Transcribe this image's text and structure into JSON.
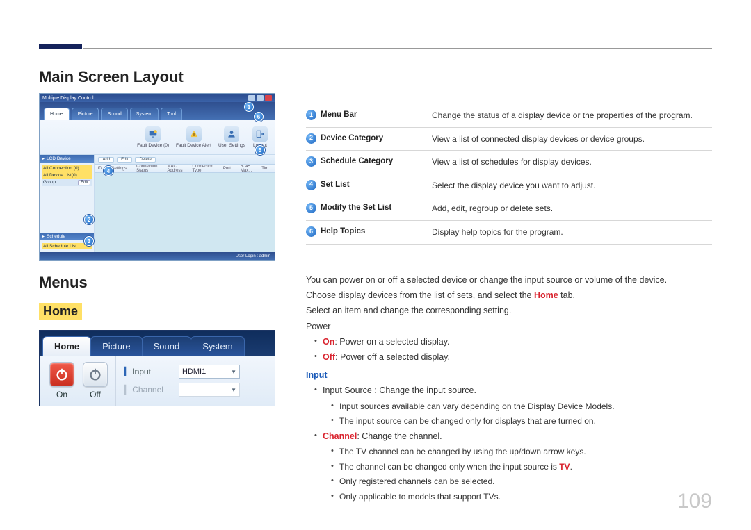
{
  "page_number": "109",
  "h_main_screen": "Main Screen Layout",
  "h_menus": "Menus",
  "h_home": "Home",
  "mdc": {
    "title": "Multiple Display Control",
    "tabs": [
      "Home",
      "Picture",
      "Sound",
      "System",
      "Tool"
    ],
    "ribbon": [
      {
        "label": "Fault Device (0)"
      },
      {
        "label": "Fault Device Alert"
      },
      {
        "label": "User Settings"
      },
      {
        "label": "Logout"
      }
    ],
    "side_lfd_hdr": "LCD Device",
    "side_all_conn": "All Connection (0)",
    "side_all_dev": "All Device List(0)",
    "side_group": "Group",
    "side_edit": "Edit",
    "side_sched_hdr": "Schedule",
    "side_sched_all": "All Schedule List",
    "toolbar": [
      "Add",
      "Edit",
      "Delete"
    ],
    "cols": [
      "ID",
      "Settings",
      "Connection Status",
      "MAC Address",
      "Connection Type",
      "Port",
      "RJ45 Max...",
      "Tim..."
    ],
    "status": "User Login : admin"
  },
  "home_detail": {
    "tabs": [
      "Home",
      "Picture",
      "Sound",
      "System"
    ],
    "power_on": "On",
    "power_off": "Off",
    "input_label": "Input",
    "input_value": "HDMI1",
    "channel_label": "Channel"
  },
  "legend": [
    {
      "n": "1",
      "term": "Menu Bar",
      "desc": "Change the status of a display device or the properties of the program."
    },
    {
      "n": "2",
      "term": "Device Category",
      "desc": "View a list of connected display devices or device groups."
    },
    {
      "n": "3",
      "term": "Schedule Category",
      "desc": "View a list of schedules for display devices."
    },
    {
      "n": "4",
      "term": "Set List",
      "desc": "Select the display device you want to adjust."
    },
    {
      "n": "5",
      "term": "Modify the Set List",
      "desc": "Add, edit, regroup or delete sets."
    },
    {
      "n": "6",
      "term": "Help Topics",
      "desc": "Display help topics for the program."
    }
  ],
  "body": {
    "p1": "You can power on or off a selected device or change the input source or volume of the device.",
    "p2_a": "Choose display devices from the list of sets, and select the ",
    "p2_home": "Home",
    "p2_b": " tab.",
    "p3": "Select an item and change the corresponding setting.",
    "power_hdr": "Power",
    "on_label": "On",
    "on_desc": ": Power on a selected display.",
    "off_label": "Off",
    "off_desc": ": Power off a selected display.",
    "input_hdr": "Input",
    "input_src": "Input Source : Change the input source.",
    "input_sub1": "Input sources available can vary depending on the Display Device Models.",
    "input_sub2": "The input source can be changed only for displays that are turned on.",
    "channel_label": "Channel",
    "channel_desc": ": Change the channel.",
    "ch_sub1": "The TV channel can be changed by using the up/down arrow keys.",
    "ch_sub2_a": "The channel can be changed only when the input source is ",
    "ch_sub2_tv": "TV",
    "ch_sub2_b": ".",
    "ch_sub3": "Only registered channels can be selected.",
    "ch_sub4": "Only applicable to models that support TVs."
  }
}
